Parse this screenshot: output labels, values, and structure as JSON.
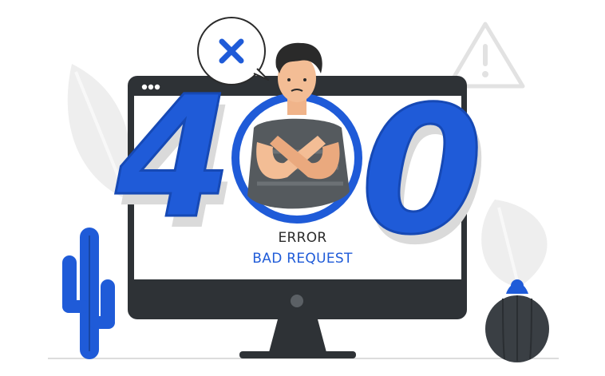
{
  "illustration": {
    "code_digits": [
      "4",
      "0",
      "0"
    ],
    "error_label": "ERROR",
    "error_description": "BAD REQUEST",
    "icons": {
      "close": "close-icon",
      "warning": "warning-icon",
      "window_dots": "window-dots-icon"
    },
    "colors": {
      "accent_blue": "#1f5bd8",
      "dark_monitor": "#2e3236",
      "light_gray": "#ebebeb",
      "shirt": "#555a5e"
    }
  }
}
